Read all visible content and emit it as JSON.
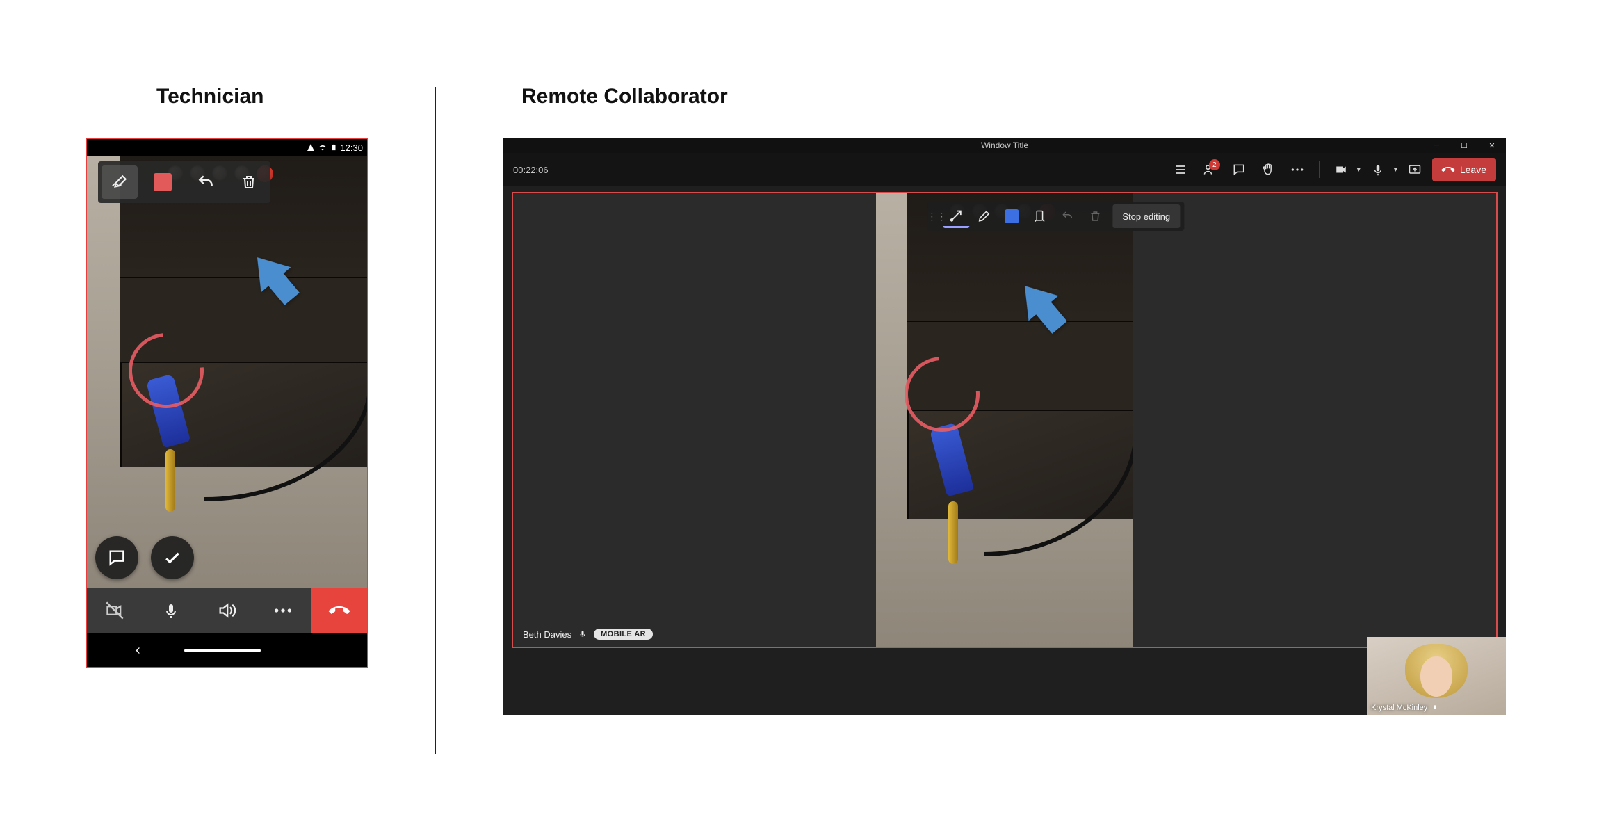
{
  "headings": {
    "technician": "Technician",
    "collaborator": "Remote Collaborator"
  },
  "mobile": {
    "status_time": "12:30",
    "toolbar": {
      "pen_icon": "pen-squiggle",
      "color": "#e25a5a",
      "undo_icon": "undo",
      "delete_icon": "trash"
    },
    "lower": {
      "chat_icon": "chat",
      "confirm_icon": "check"
    },
    "controls": {
      "camera_icon": "camera-off",
      "mic_icon": "mic",
      "speaker_icon": "speaker",
      "more_icon": "more",
      "hangup_icon": "hangup"
    },
    "annotation": {
      "circle_color": "#e85e64",
      "arrow_color": "#4b8ecf"
    }
  },
  "desktop": {
    "window_title": "Window Title",
    "timer": "00:22:06",
    "topbar": {
      "people_icon": "people-list",
      "people_count_icon": "add-person",
      "people_badge": "2",
      "chat_icon": "chat",
      "raise_hand_icon": "raise-hand",
      "more_icon": "more",
      "camera_icon": "camera",
      "mic_icon": "mic",
      "share_icon": "share-screen",
      "leave_label": "Leave",
      "leave_icon": "hangup"
    },
    "mr_toolbar": {
      "handle_icon": "drag-handle",
      "arrow3d_icon": "3d-arrow",
      "pen_icon": "pen",
      "color": "#3c6fe2",
      "place_icon": "place-object",
      "undo_icon": "undo",
      "delete_icon": "trash",
      "stop_label": "Stop editing"
    },
    "participant": {
      "name": "Beth Davies",
      "mic_icon": "mic",
      "mode_tag": "MOBILE AR"
    },
    "self_view": {
      "name": "Krystal McKinley",
      "mic_icon": "mic"
    },
    "win_controls": {
      "min": "minimize",
      "max": "maximize",
      "close": "close"
    }
  }
}
